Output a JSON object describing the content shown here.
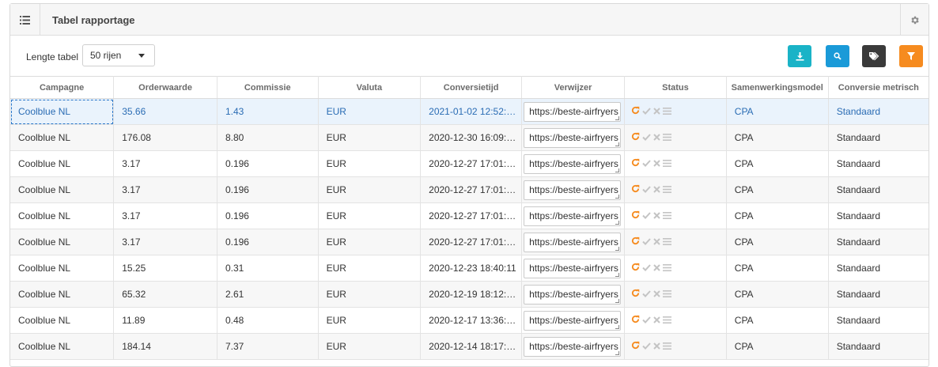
{
  "panel": {
    "title": "Tabel rapportage",
    "menu_icon": "list-icon",
    "settings_icon": "gear-icon"
  },
  "toolbar": {
    "length_label": "Lengte tabel",
    "length_value": "50 rijen",
    "buttons": [
      {
        "name": "download-button",
        "icon": "download-icon",
        "color": "#1ab3c7"
      },
      {
        "name": "search-button",
        "icon": "search-icon",
        "color": "#1a9ad8"
      },
      {
        "name": "tags-button",
        "icon": "tags-icon",
        "color": "#3a3a3a"
      },
      {
        "name": "filter-button",
        "icon": "filter-icon",
        "color": "#f68b1f"
      }
    ]
  },
  "colors": {
    "accent_link": "#2a6cb4",
    "status_refresh": "#f68b1f",
    "status_muted": "#c4c4c4",
    "selected_row": "#eaf3fc"
  },
  "table": {
    "columns": [
      "Campagne",
      "Orderwaarde",
      "Commissie",
      "Valuta",
      "Conversietijd",
      "Verwijzer",
      "Status",
      "Samenwerkingsmodel",
      "Conversie metrisch"
    ],
    "rows": [
      [
        "Coolblue NL",
        "35.66",
        "1.43",
        "EUR",
        "2021-01-02 12:52:…",
        "https://beste-airfryers",
        "",
        "CPA",
        "Standaard"
      ],
      [
        "Coolblue NL",
        "176.08",
        "8.80",
        "EUR",
        "2020-12-30 16:09:…",
        "https://beste-airfryers",
        "",
        "CPA",
        "Standaard"
      ],
      [
        "Coolblue NL",
        "3.17",
        "0.196",
        "EUR",
        "2020-12-27 17:01:…",
        "https://beste-airfryers",
        "",
        "CPA",
        "Standaard"
      ],
      [
        "Coolblue NL",
        "3.17",
        "0.196",
        "EUR",
        "2020-12-27 17:01:…",
        "https://beste-airfryers",
        "",
        "CPA",
        "Standaard"
      ],
      [
        "Coolblue NL",
        "3.17",
        "0.196",
        "EUR",
        "2020-12-27 17:01:…",
        "https://beste-airfryers",
        "",
        "CPA",
        "Standaard"
      ],
      [
        "Coolblue NL",
        "3.17",
        "0.196",
        "EUR",
        "2020-12-27 17:01:…",
        "https://beste-airfryers",
        "",
        "CPA",
        "Standaard"
      ],
      [
        "Coolblue NL",
        "15.25",
        "0.31",
        "EUR",
        "2020-12-23 18:40:11",
        "https://beste-airfryers",
        "",
        "CPA",
        "Standaard"
      ],
      [
        "Coolblue NL",
        "65.32",
        "2.61",
        "EUR",
        "2020-12-19 18:12:…",
        "https://beste-airfryers",
        "",
        "CPA",
        "Standaard"
      ],
      [
        "Coolblue NL",
        "11.89",
        "0.48",
        "EUR",
        "2020-12-17 13:36:…",
        "https://beste-airfryers",
        "",
        "CPA",
        "Standaard"
      ],
      [
        "Coolblue NL",
        "184.14",
        "7.37",
        "EUR",
        "2020-12-14 18:17:…",
        "https://beste-airfryers",
        "",
        "CPA",
        "Standaard"
      ]
    ],
    "status_icons": [
      "refresh-icon",
      "check-icon",
      "close-icon",
      "menu-icon"
    ]
  }
}
